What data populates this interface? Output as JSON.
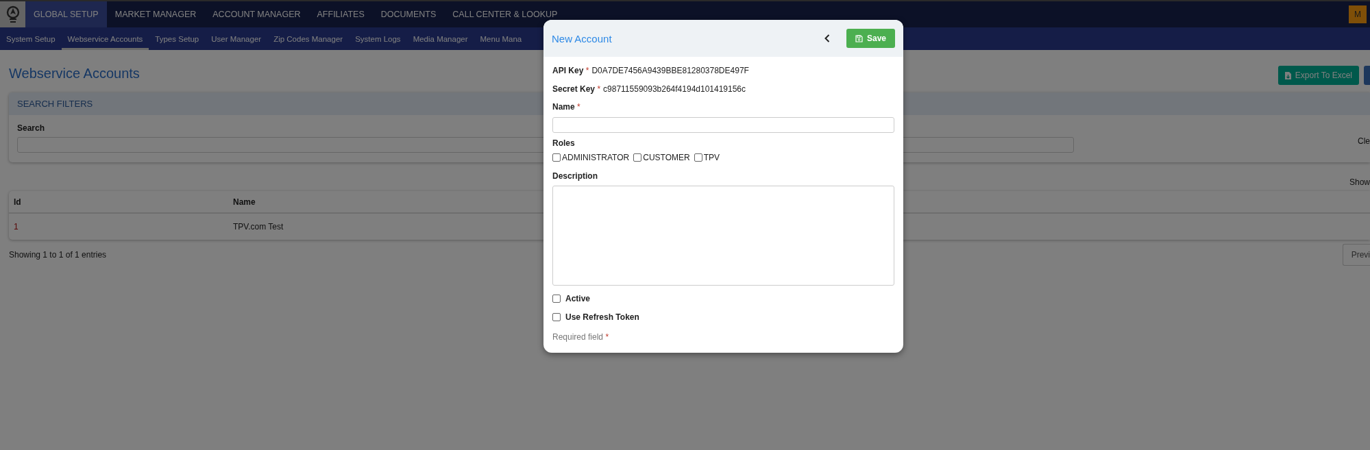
{
  "top_nav": {
    "items": [
      {
        "label": "GLOBAL SETUP",
        "selected": true
      },
      {
        "label": "MARKET MANAGER",
        "selected": false
      },
      {
        "label": "ACCOUNT MANAGER",
        "selected": false
      },
      {
        "label": "AFFILIATES",
        "selected": false
      },
      {
        "label": "DOCUMENTS",
        "selected": false
      },
      {
        "label": "CALL CENTER & LOOKUP",
        "selected": false
      }
    ],
    "avatar": "M"
  },
  "sub_nav": [
    {
      "label": "System Setup",
      "selected": false
    },
    {
      "label": "Webservice Accounts",
      "selected": true
    },
    {
      "label": "Types Setup",
      "selected": false
    },
    {
      "label": "User Manager",
      "selected": false
    },
    {
      "label": "Zip Codes Manager",
      "selected": false
    },
    {
      "label": "System Logs",
      "selected": false
    },
    {
      "label": "Media Manager",
      "selected": false
    },
    {
      "label": "Menu Mana",
      "selected": false
    }
  ],
  "page": {
    "title": "Webservice Accounts",
    "export_button": "Export To Excel",
    "search_filters": {
      "title": "SEARCH FILTERS",
      "search_label": "Search",
      "clear": "Cle"
    },
    "show_label": "Show",
    "table": {
      "columns": [
        "Id",
        "Name"
      ],
      "rows": [
        [
          "1",
          "TPV.com Test"
        ]
      ]
    },
    "info": "Showing 1 to 1 of 1 entries",
    "pagination": [
      "Previ"
    ]
  },
  "modal": {
    "title": "New Account",
    "save_button": "Save",
    "keys": [
      {
        "label": "API Key",
        "required_mark": "*",
        "value": "D0A7DE7456A9439BBE81280378DE497F"
      },
      {
        "label": "Secret Key",
        "required_mark": "*",
        "value": "c98711559093b264f4194d101419156c"
      }
    ],
    "name_field": {
      "label": "Name",
      "required_mark": "*"
    },
    "roles": {
      "label": "Roles",
      "options": [
        {
          "label": "ADMINISTRATOR",
          "checked": false
        },
        {
          "label": "CUSTOMER",
          "checked": false
        },
        {
          "label": "TPV",
          "checked": false
        }
      ]
    },
    "description_field": {
      "label": "Description"
    },
    "switches": [
      {
        "label": "Active",
        "checked": false
      },
      {
        "label": "Use Refresh Token",
        "checked": false
      }
    ],
    "footer": {
      "text": "Required field",
      "required_mark": "*"
    }
  }
}
